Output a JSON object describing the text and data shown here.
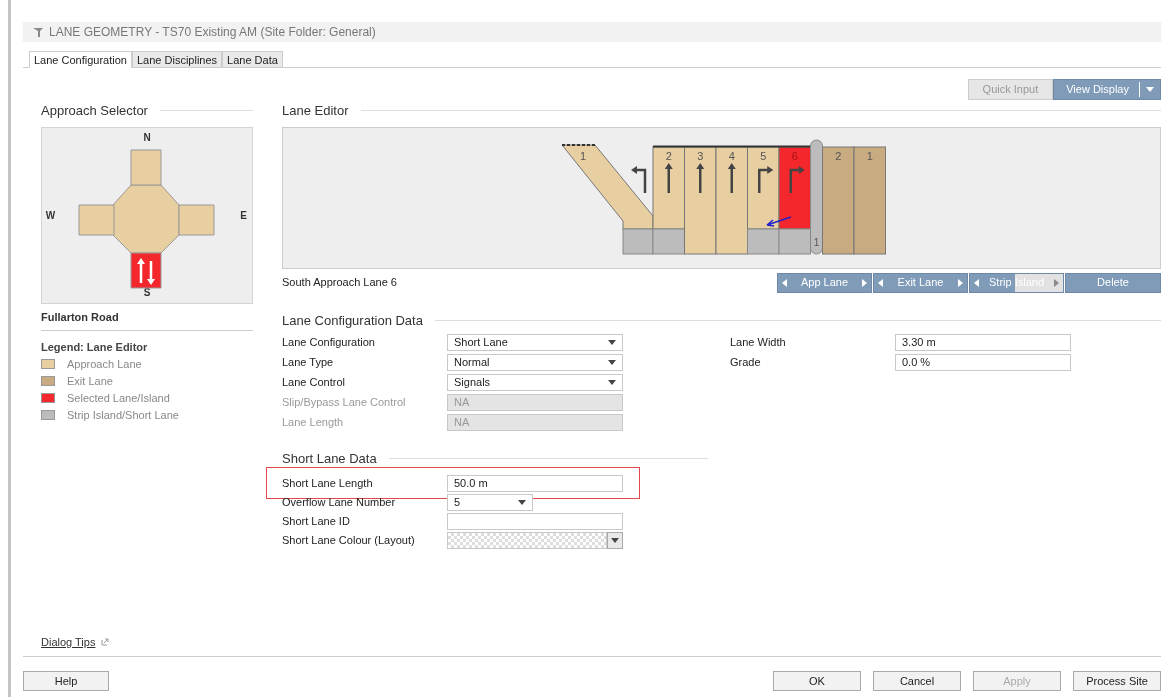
{
  "window": {
    "title": "LANE GEOMETRY - TS70 Existing AM (Site Folder: General)"
  },
  "tabs": [
    {
      "label": "Lane Configuration",
      "selected": true
    },
    {
      "label": "Lane Disciplines",
      "selected": false
    },
    {
      "label": "Lane Data",
      "selected": false
    }
  ],
  "toolbar": [
    {
      "label": "Quick Input",
      "disabled": true,
      "dropdown": false
    },
    {
      "label": "View Display",
      "disabled": false,
      "dropdown": true
    }
  ],
  "approach_selector": {
    "title": "Approach Selector",
    "approaches": [
      {
        "label": "N",
        "selected": false
      },
      {
        "label": "W",
        "selected": false
      },
      {
        "label": "E",
        "selected": false
      },
      {
        "label": "S",
        "selected": true
      }
    ],
    "road_name": "Fullarton Road"
  },
  "legend": {
    "title": "Legend: Lane Editor",
    "items": [
      {
        "label": "Approach Lane",
        "color": "#e8cfa2"
      },
      {
        "label": "Exit Lane",
        "color": "#c8ab80"
      },
      {
        "label": "Selected Lane/Island",
        "color": "#f4282c"
      },
      {
        "label": "Strip Island/Short Lane",
        "color": "#bcbcbc"
      }
    ]
  },
  "lane_editor": {
    "title": "Lane Editor",
    "approach_lanes": [
      {
        "number": "1",
        "kind": "left",
        "selected": false,
        "short": true
      },
      {
        "number": "2",
        "kind": "straight",
        "selected": false,
        "short": true
      },
      {
        "number": "3",
        "kind": "straight",
        "selected": false,
        "short": false
      },
      {
        "number": "4",
        "kind": "straight",
        "selected": false,
        "short": false
      },
      {
        "number": "5",
        "kind": "right",
        "selected": false,
        "short": true
      },
      {
        "number": "6",
        "kind": "right",
        "selected": true,
        "short": true
      }
    ],
    "island": "1",
    "exit_lanes": [
      "2",
      "1"
    ],
    "caption": "South Approach Lane 6",
    "buttons": [
      {
        "label": "App Lane",
        "kind": "stepper"
      },
      {
        "label": "Exit Lane",
        "kind": "stepper"
      },
      {
        "label": "Strip Island",
        "kind": "stepper"
      },
      {
        "label": "Delete",
        "kind": "plain"
      }
    ]
  },
  "lane_configuration_data": {
    "title": "Lane Configuration Data",
    "fields": [
      {
        "label": "Lane Configuration",
        "value": "Short Lane",
        "kind": "select",
        "disabled": false
      },
      {
        "label": "Lane Type",
        "value": "Normal",
        "kind": "select",
        "disabled": false
      },
      {
        "label": "Lane Control",
        "value": "Signals",
        "kind": "select",
        "disabled": false
      },
      {
        "label": "Slip/Bypass Lane Control",
        "value": "NA",
        "kind": "text",
        "disabled": true
      },
      {
        "label": "Lane Length",
        "value": "NA",
        "kind": "text",
        "disabled": true
      }
    ],
    "side_fields": [
      {
        "label": "Lane Width",
        "value": "3.30 m",
        "kind": "text",
        "disabled": false
      },
      {
        "label": "Grade",
        "value": "0.0 %",
        "kind": "text",
        "disabled": false
      }
    ]
  },
  "short_lane_data": {
    "title": "Short Lane Data",
    "fields": [
      {
        "label": "Short Lane Length",
        "value": "50.0 m",
        "kind": "text",
        "disabled": false,
        "highlighted": true
      },
      {
        "label": "Overflow Lane Number",
        "value": "5",
        "kind": "small_select",
        "disabled": false,
        "highlighted": false
      },
      {
        "label": "Short Lane ID",
        "kind": "text",
        "disabled": false,
        "highlighted": false
      },
      {
        "label": "Short Lane Colour (Layout)",
        "kind": "colour",
        "disabled": false,
        "highlighted": false
      }
    ]
  },
  "footer": {
    "link": "Dialog Tips",
    "left_buttons": [
      {
        "label": "Help",
        "disabled": false
      }
    ],
    "right_buttons": [
      {
        "label": "OK",
        "disabled": false
      },
      {
        "label": "Cancel",
        "disabled": false
      },
      {
        "label": "Apply",
        "disabled": true
      },
      {
        "label": "Process Site",
        "disabled": false
      }
    ]
  }
}
